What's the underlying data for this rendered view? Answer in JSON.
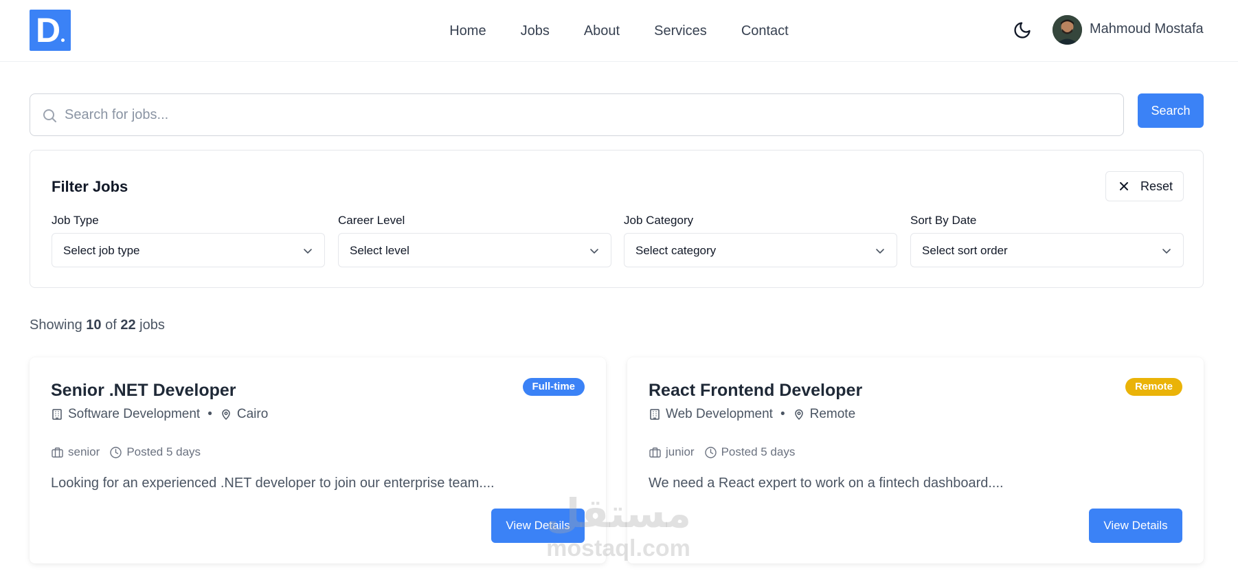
{
  "header": {
    "logo_letter": "D",
    "nav": [
      "Home",
      "Jobs",
      "About",
      "Services",
      "Contact"
    ],
    "user_name": "Mahmoud Mostafa"
  },
  "search": {
    "placeholder": "Search for jobs...",
    "button_label": "Search"
  },
  "filters": {
    "title": "Filter Jobs",
    "reset_label": "Reset",
    "groups": [
      {
        "label": "Job Type",
        "value": "Select job type"
      },
      {
        "label": "Career Level",
        "value": "Select level"
      },
      {
        "label": "Job Category",
        "value": "Select category"
      },
      {
        "label": "Sort By Date",
        "value": "Select sort order"
      }
    ]
  },
  "results": {
    "prefix": "Showing",
    "shown": "10",
    "of": "of",
    "total": "22",
    "suffix": "jobs"
  },
  "jobs": [
    {
      "title": "Senior .NET Developer",
      "badge": "Full-time",
      "badge_color": "#3b82f6",
      "category": "Software Development",
      "location": "Cairo",
      "level": "senior",
      "posted": "Posted 5 days",
      "description": "Looking for an experienced .NET developer to join our enterprise team....",
      "button_label": "View Details"
    },
    {
      "title": "React Frontend Developer",
      "badge": "Remote",
      "badge_color": "#eab308",
      "category": "Web Development",
      "location": "Remote",
      "level": "junior",
      "posted": "Posted 5 days",
      "description": "We need a React expert to work on a fintech dashboard....",
      "button_label": "View Details"
    }
  ],
  "watermark": {
    "arabic": "مستقل",
    "latin": "mostaql.com"
  },
  "colors": {
    "primary": "#3b82f6",
    "warning": "#eab308"
  }
}
